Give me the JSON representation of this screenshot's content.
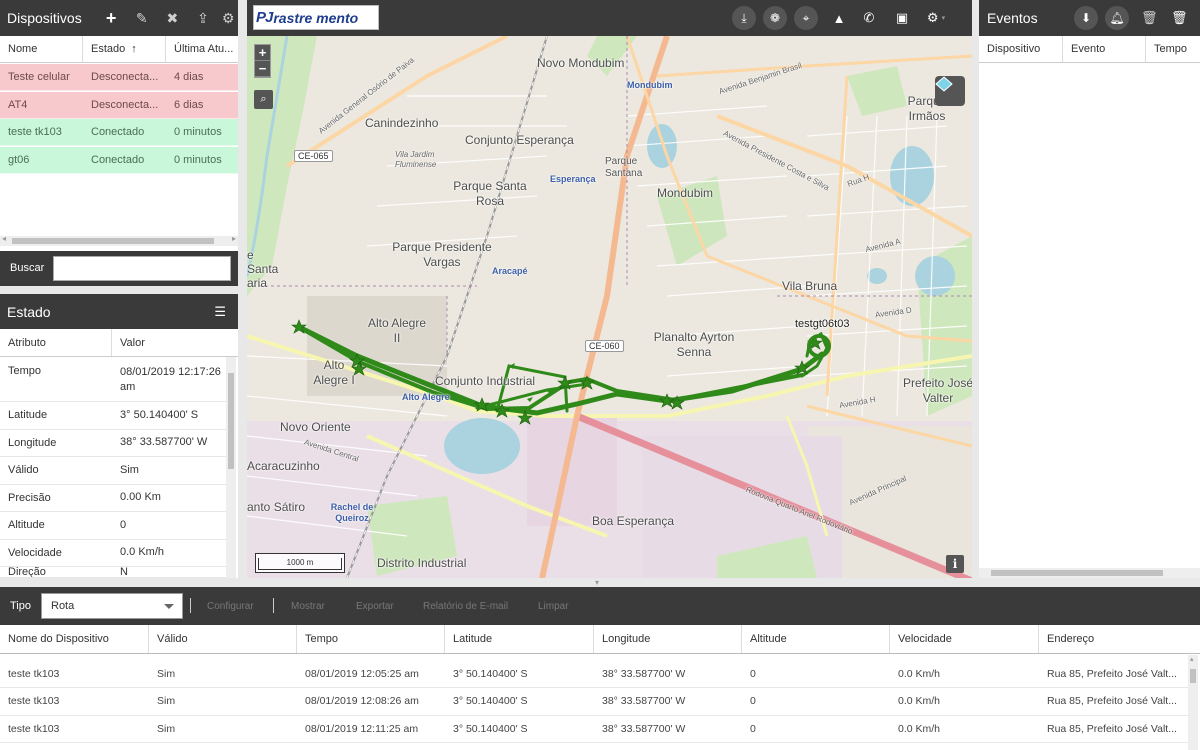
{
  "devices_panel": {
    "title": "Dispositivos",
    "columns": [
      "Nome",
      "Estado",
      "Última Atu..."
    ],
    "sort_arrow": "↑",
    "rows": [
      {
        "name": "Teste celular",
        "status": "Desconecta...",
        "last": "4 dias",
        "state": "off"
      },
      {
        "name": "AT4",
        "status": "Desconecta...",
        "last": "6 dias",
        "state": "off"
      },
      {
        "name": "teste tk103",
        "status": "Conectado",
        "last": "0 minutos",
        "state": "on"
      },
      {
        "name": "gt06",
        "status": "Conectado",
        "last": "0 minutos",
        "state": "on"
      }
    ],
    "search_label": "Buscar",
    "search_value": "",
    "toolbar_icons": [
      "plus-icon",
      "edit-icon",
      "remove-icon",
      "upload-icon",
      "gear-icon"
    ]
  },
  "state_panel": {
    "title": "Estado",
    "columns": [
      "Atributo",
      "Valor"
    ],
    "rows": [
      {
        "key": "Tempo",
        "value": "08/01/2019 12:17:26 am"
      },
      {
        "key": "Latitude",
        "value": "3° 50.140400' S"
      },
      {
        "key": "Longitude",
        "value": "38° 33.587700' W"
      },
      {
        "key": "Válido",
        "value": "Sim"
      },
      {
        "key": "Precisão",
        "value": "0.00 Km"
      },
      {
        "key": "Altitude",
        "value": "0"
      },
      {
        "key": "Velocidade",
        "value": "0.0 Km/h"
      },
      {
        "key": "Direção",
        "value": "N"
      }
    ]
  },
  "map": {
    "logo_pj": "PJ",
    "logo_text": "rastre mento",
    "device_label": "testgt06t03",
    "scale": "1000 m",
    "zoom_in": "+",
    "zoom_out": "−",
    "info": "i",
    "toolbar_icons": [
      "download-icon",
      "paw-icon",
      "locate-icon",
      "road-icon",
      "whatsapp-icon",
      "camera-icon",
      "gear-icon"
    ],
    "labels": {
      "novo_mondubim": "Novo Mondubim",
      "mondubim_small": "Mondubim",
      "canindezinho": "Canindezinho",
      "conjunto_esperanca": "Conjunto Esperança",
      "vila_jardim": "Vila Jardim Fluminense",
      "parque_santana": "Parque Santana",
      "esperanca": "Esperança",
      "parque_santa_rosa": "Parque Santa Rosa",
      "mondubim": "Mondubim",
      "parque_presidente_vargas": "Parque Presidente Vargas",
      "aracape": "Aracapé",
      "alto_alegre_ii": "Alto Alegre II",
      "alto_alegre_i": "Alto Alegre I",
      "alto_alegre_blue": "Alto Alegre",
      "conjunto_industrial": "Conjunto Industrial",
      "planalto": "Planalto Ayrton Senna",
      "vila_bruna": "Vila Bruna",
      "parque_irmaos": "Parque Irmãos",
      "prefeito_jose_valter": "Prefeito José Valter",
      "novo_oriente": "Novo Oriente",
      "acaracuzinho": "Acaracuzinho",
      "santo_satiro": "anto Sátiro",
      "rachel": "Rachel de Queiroz",
      "boa_esperanca": "Boa Esperança",
      "distrito_industrial": "Distrito Industrial",
      "santa_maria": "e Santa aria",
      "ce065": "CE-065",
      "ce060": "CE-060",
      "av_godofredo": "Avenida General Osório de Paiva",
      "av_benjamin": "Avenida Benjamin Brasil",
      "av_costa_silva": "Avenida Presidente Costa e Silva",
      "rodovia": "Rodovia Quarto Anel Rodoviário",
      "av_central": "Avenida Central",
      "av_principal": "Avenida Principal",
      "av_a": "Avenida A",
      "av_d": "Avenida D",
      "av_h": "Avenida H",
      "rua_h": "Rua H"
    }
  },
  "events_panel": {
    "title": "Eventos",
    "columns": [
      "Dispositivo",
      "Evento",
      "Tempo"
    ],
    "toolbar_icons": [
      "arrow-down-icon",
      "bell-icon",
      "trash-icon",
      "trash-icon"
    ]
  },
  "report": {
    "type_label": "Tipo",
    "type_value": "Rota",
    "actions": [
      "Configurar",
      "Mostrar",
      "Exportar",
      "Relatório de E-mail",
      "Limpar"
    ],
    "columns": [
      "Nome do Dispositivo",
      "Válido",
      "Tempo",
      "Latitude",
      "Longitude",
      "Altitude",
      "Velocidade",
      "Endereço"
    ],
    "rows": [
      [
        "teste tk103",
        "Sim",
        "08/01/2019 12:05:25 am",
        "3° 50.140400' S",
        "38° 33.587700' W",
        "0",
        "0.0 Km/h",
        "Rua 85, Prefeito José Valt..."
      ],
      [
        "teste tk103",
        "Sim",
        "08/01/2019 12:08:26 am",
        "3° 50.140400' S",
        "38° 33.587700' W",
        "0",
        "0.0 Km/h",
        "Rua 85, Prefeito José Valt..."
      ],
      [
        "teste tk103",
        "Sim",
        "08/01/2019 12:11:25 am",
        "3° 50.140400' S",
        "38° 33.587700' W",
        "0",
        "0.0 Km/h",
        "Rua 85, Prefeito José Valt..."
      ]
    ]
  },
  "colors": {
    "header_bg": "#3a3a3a",
    "disconnected_row": "#f8c9cc",
    "connected_row": "#c9f7da",
    "route": "#2e8b1f"
  }
}
